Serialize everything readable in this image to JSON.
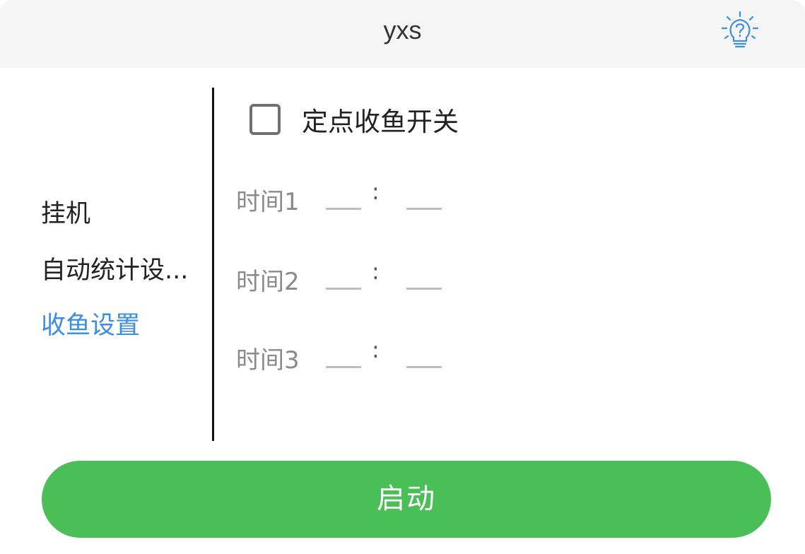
{
  "window": {
    "title": "yxs",
    "help_icon": "lightbulb-question-icon"
  },
  "sidebar": {
    "items": [
      {
        "label": "挂机",
        "active": false
      },
      {
        "label": "自动统计设...",
        "active": false
      },
      {
        "label": "收鱼设置",
        "active": true
      }
    ]
  },
  "settings": {
    "toggle": {
      "label": "定点收鱼开关",
      "checked": false
    },
    "times": [
      {
        "label": "时间1",
        "hour": "",
        "minute": "",
        "separator": ":"
      },
      {
        "label": "时间2",
        "hour": "",
        "minute": "",
        "separator": ":"
      },
      {
        "label": "时间3",
        "hour": "",
        "minute": "",
        "separator": ":"
      }
    ]
  },
  "actions": {
    "start_label": "启动"
  },
  "colors": {
    "accent_blue": "#3a8ee6",
    "button_green": "#4abf58",
    "titlebar_bg": "#f5f5f5"
  }
}
